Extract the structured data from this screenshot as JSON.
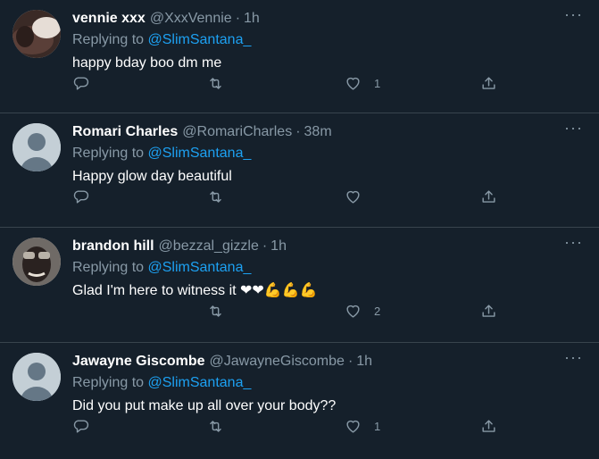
{
  "tweets": [
    {
      "name": "vennie xxx",
      "handle": "@XxxVennie",
      "dot": "·",
      "time": "1h",
      "replying_prefix": "Replying to ",
      "replying_to": "@SlimSantana_",
      "text": "happy bday boo dm me",
      "like_count": "1",
      "avatar": "photo"
    },
    {
      "name": "Romari Charles",
      "handle": "@RomariCharles",
      "dot": "·",
      "time": "38m",
      "replying_prefix": "Replying to ",
      "replying_to": "@SlimSantana_",
      "text": "Happy glow day beautiful",
      "like_count": "",
      "avatar": "default"
    },
    {
      "name": "brandon hill",
      "handle": "@bezzal_gizzle",
      "dot": "·",
      "time": "1h",
      "replying_prefix": "Replying to ",
      "replying_to": "@SlimSantana_",
      "text": "Glad I'm here to witness it ❤❤💪💪💪",
      "like_count": "2",
      "avatar": "photo"
    },
    {
      "name": "Jawayne Giscombe",
      "handle": "@JawayneGiscombe",
      "dot": "·",
      "time": "1h",
      "replying_prefix": "Replying to ",
      "replying_to": "@SlimSantana_",
      "text": "Did you put make up all over your body??",
      "like_count": "1",
      "avatar": "default"
    }
  ],
  "icons": {
    "more": "more-dots-icon",
    "reply": "reply-icon",
    "retweet": "retweet-icon",
    "like": "heart-icon",
    "share": "share-icon"
  },
  "more_glyph": "···",
  "colors": {
    "background": "#15202b",
    "divider": "#38444d",
    "secondary_text": "#8899a6",
    "link": "#1da1f2"
  }
}
